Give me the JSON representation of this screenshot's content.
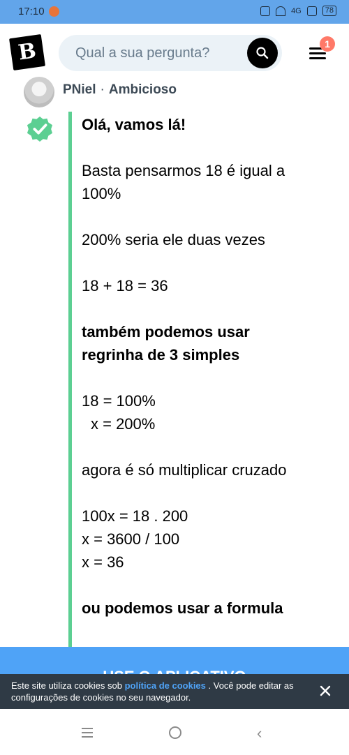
{
  "status_bar": {
    "time": "17:10",
    "network": "4G",
    "battery": "78"
  },
  "header": {
    "logo_letter": "B",
    "search": {
      "placeholder": "Qual a sua pergunta?"
    },
    "notification_count": "1"
  },
  "answer": {
    "user_name": "PNiel",
    "separator": "·",
    "user_rank": "Ambicioso",
    "lines": {
      "greeting": "Olá, vamos lá!",
      "l1a": "Basta pensarmos 18 é igual a",
      "l1b": "100%",
      "l2": "200% seria ele duas vezes",
      "l3": "18 + 18 = 36",
      "l4a": "também podemos usar",
      "l4b": "regrinha de 3 simples",
      "l5a": "18 = 100%",
      "l5b": "x = 200%",
      "l6": "agora é só multiplicar cruzado",
      "l7a": "100x = 18 . 200",
      "l7b": "x = 3600 / 100",
      "l7c": "x = 36",
      "l8": "ou podemos usar a formula"
    }
  },
  "app_banner": {
    "label": "USE O APLICATIVO"
  },
  "cookie_banner": {
    "text_before": "Este site utiliza cookies sob ",
    "link": "política de cookies",
    "text_after": " . Você pode editar as configurações de cookies no seu navegador."
  },
  "icons": {
    "search": "search-icon",
    "menu": "hamburger-menu-icon",
    "verified": "verified-check-icon",
    "close": "close-icon"
  },
  "colors": {
    "status_bar": "#62a5ea",
    "accent_green": "#5ccf92",
    "notification": "#ff7968",
    "app_banner": "#4fa3f7",
    "cookie_banner": "#2f3a45"
  }
}
